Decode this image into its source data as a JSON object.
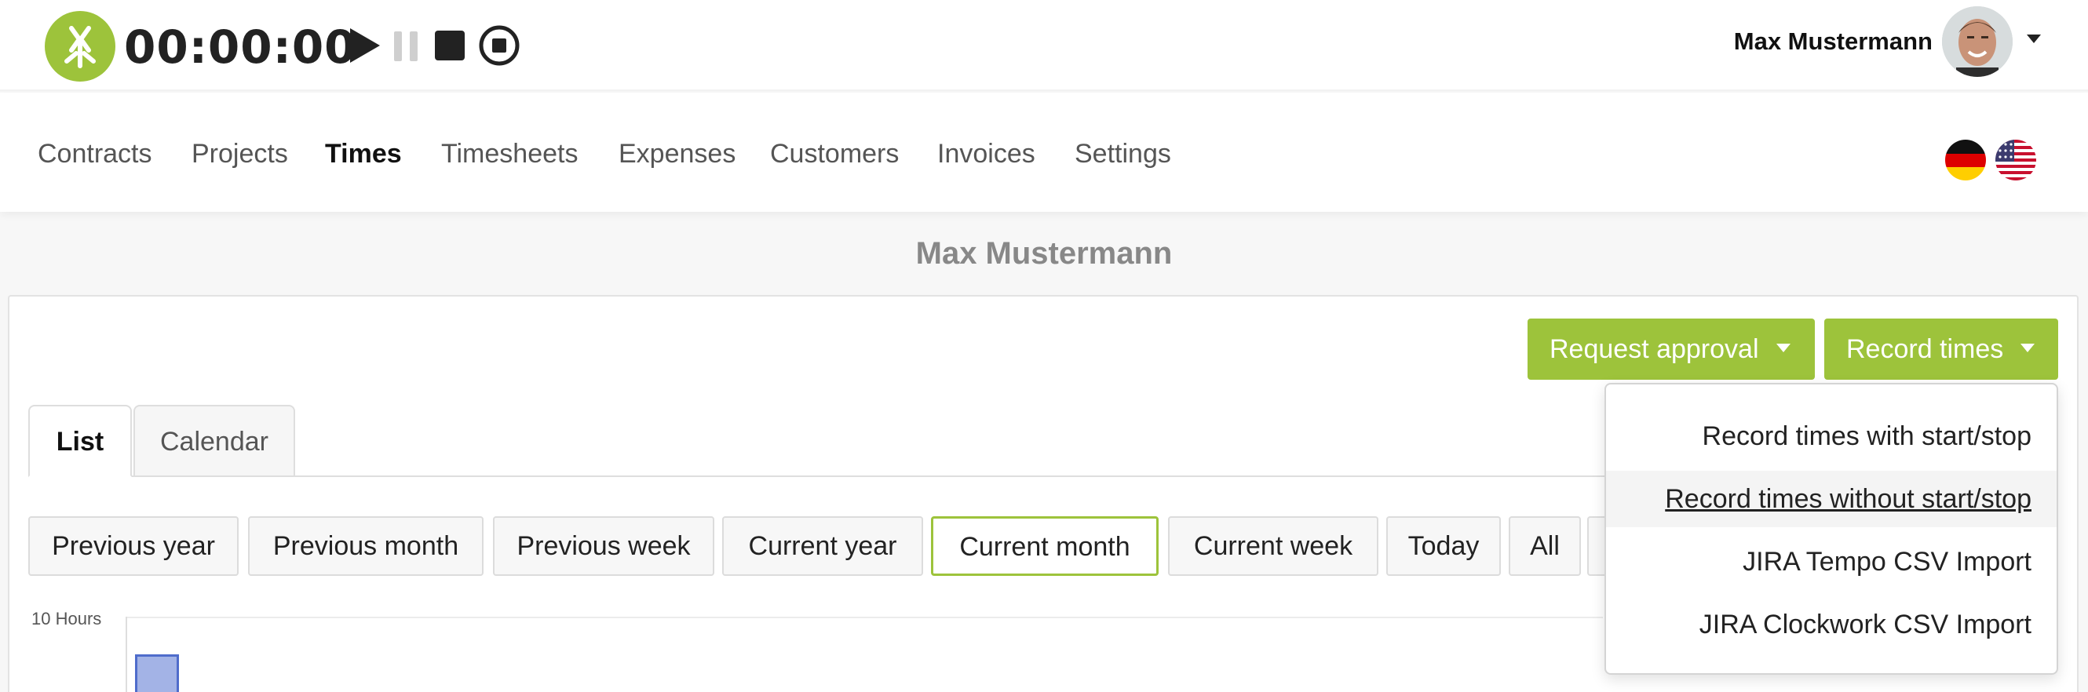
{
  "app": {
    "timer": "00:00:00",
    "user_name": "Max Mustermann",
    "brand_color": "#9dc33b",
    "icons": {
      "logo": "app-logo-icon",
      "play": "play-icon",
      "pause": "pause-icon",
      "stop": "stop-icon",
      "record": "record-stop-icon",
      "user_menu": "caret-down-icon"
    }
  },
  "nav": {
    "items": [
      {
        "label": "Contracts"
      },
      {
        "label": "Projects"
      },
      {
        "label": "Times",
        "active": true
      },
      {
        "label": "Timesheets"
      },
      {
        "label": "Expenses"
      },
      {
        "label": "Customers"
      },
      {
        "label": "Invoices"
      },
      {
        "label": "Settings"
      }
    ],
    "languages": [
      "de-flag",
      "us-flag"
    ]
  },
  "page": {
    "heading": "Max Mustermann"
  },
  "actions": {
    "request_approval": "Request approval",
    "record_times": "Record times"
  },
  "tabs": [
    {
      "label": "List",
      "active": true
    },
    {
      "label": "Calendar",
      "active": false
    }
  ],
  "filters": [
    {
      "label": "Previous year"
    },
    {
      "label": "Previous month"
    },
    {
      "label": "Previous week"
    },
    {
      "label": "Current year"
    },
    {
      "label": "Current month",
      "active": true
    },
    {
      "label": "Current week"
    },
    {
      "label": "Today"
    },
    {
      "label": "All"
    }
  ],
  "chart": {
    "y_max_label": "10 Hours"
  },
  "dropdown": {
    "items": [
      {
        "label": "Record times with start/stop"
      },
      {
        "label": "Record times without start/stop",
        "hover": true
      },
      {
        "label": "JIRA Tempo CSV Import"
      },
      {
        "label": "JIRA Clockwork CSV Import"
      }
    ]
  }
}
